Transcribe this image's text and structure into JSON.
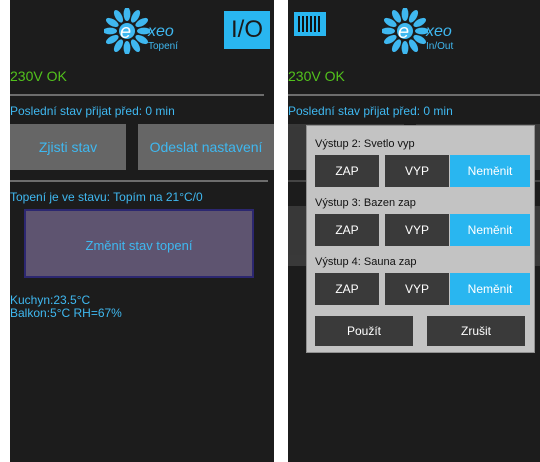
{
  "left_screen": {
    "brand": "xeo",
    "subtitle": "Topení",
    "io_button": "I/O",
    "power_status": "230V OK",
    "last_state": "Poslední stav přijat před: 0 min",
    "buttons": {
      "get_state": "Zjisti stav",
      "send_settings": "Odeslat nastavení"
    },
    "heating_status": "Topení je ve stavu: Topím na 21°C/0",
    "change_heating": "Změnit stav topení",
    "temps": [
      "Kuchyn:23.5°C",
      "Balkon:5°C RH=67%"
    ]
  },
  "right_screen": {
    "brand": "xeo",
    "subtitle": "In/Out",
    "power_status": "230V OK",
    "last_state": "Poslední stav přijat před: 0 min",
    "dialog": {
      "outputs": [
        {
          "label": "Výstup 2: Svetlo vyp",
          "on": "ZAP",
          "off": "VYP",
          "keep": "Neměnit",
          "selected": "keep"
        },
        {
          "label": "Výstup 3: Bazen zap",
          "on": "ZAP",
          "off": "VYP",
          "keep": "Neměnit",
          "selected": "keep"
        },
        {
          "label": "Výstup 4: Sauna zap",
          "on": "ZAP",
          "off": "VYP",
          "keep": "Neměnit",
          "selected": "keep"
        }
      ],
      "apply": "Použít",
      "cancel": "Zrušit"
    }
  },
  "colors": {
    "accent": "#29b6f0",
    "ok_green": "#52c21c",
    "background": "#1c1c1c",
    "button_gray": "#666666",
    "dialog": "#c3c3c3"
  },
  "icons": [
    "sun-logo-icon",
    "barcode-icon"
  ]
}
